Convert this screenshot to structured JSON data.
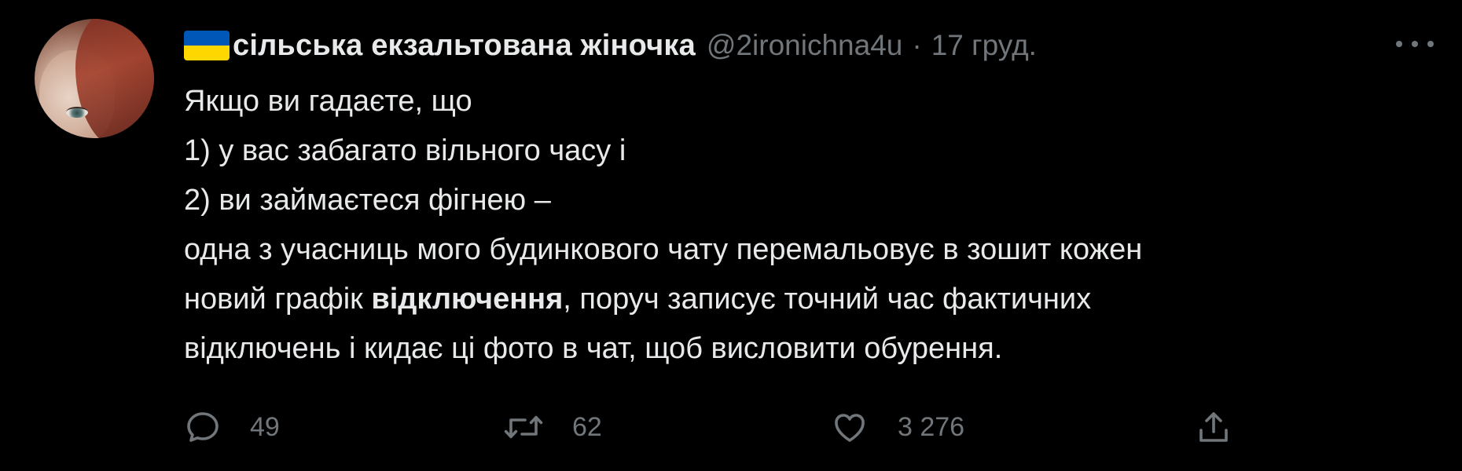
{
  "tweet": {
    "display_name": "сільська екзальтована жіночка",
    "flag_icon": "ukraine-flag-icon",
    "handle": "@2ironichna4u",
    "separator": "·",
    "date": "17 груд.",
    "more_icon": "more-dots-icon",
    "text": {
      "line1": "Якщо ви гадаєте, що",
      "line2": "1) у вас забагато вільного часу і",
      "line3": "2) ви займаєтеся фігнею –",
      "line4": "одна з учасниць мого будинкового чату перемальовує в зошит кожен",
      "line5_before": "новий графік ",
      "line5_bold": "відключення",
      "line5_after": ", поруч записує точний час фактичних",
      "line6": "відключень і кидає ці фото в чат, щоб висловити обурення."
    },
    "actions": {
      "reply_count": "49",
      "retweet_count": "62",
      "like_count": "3 276"
    }
  },
  "colors": {
    "background": "#000000",
    "text_primary": "#e7e9ea",
    "text_secondary": "#71767b",
    "flag_blue": "#0057b7",
    "flag_yellow": "#ffd700"
  }
}
